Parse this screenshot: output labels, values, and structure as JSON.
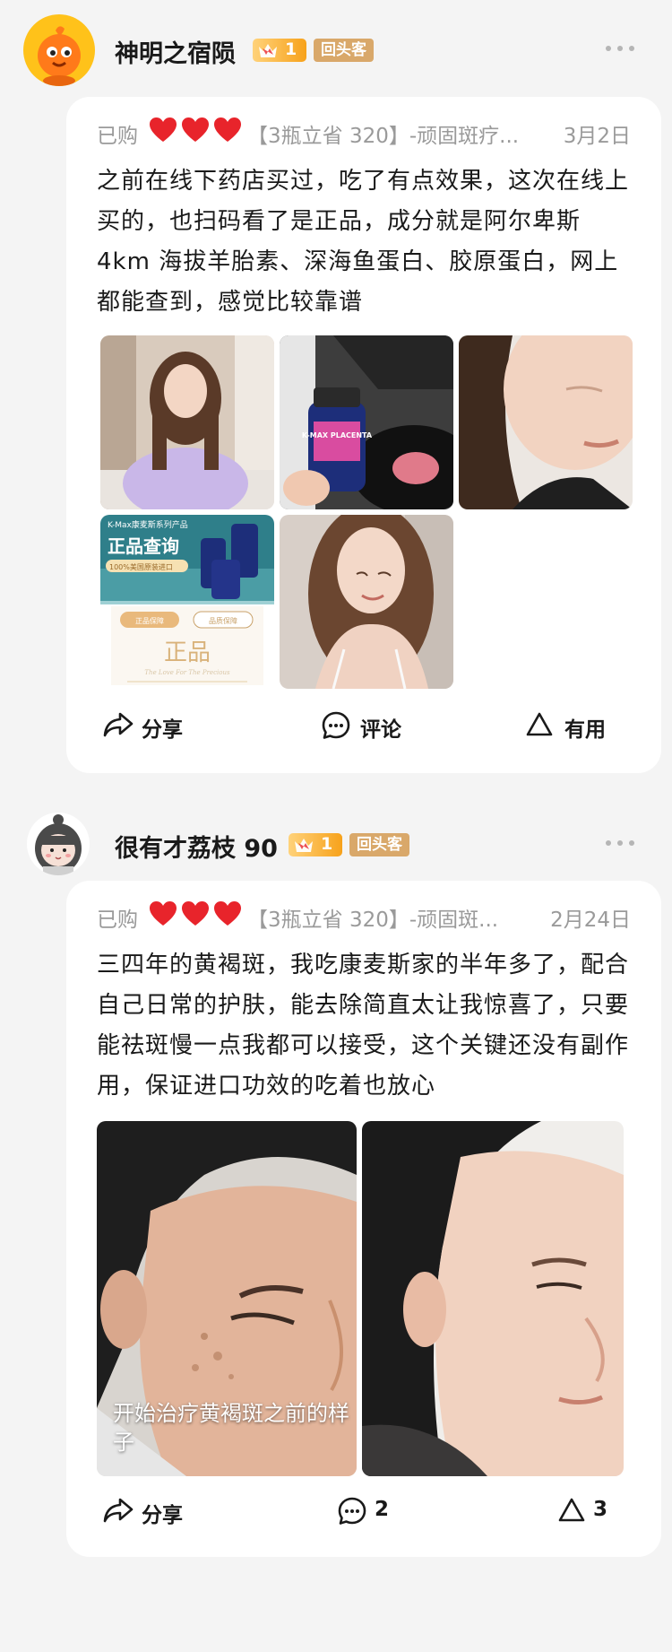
{
  "reviews": [
    {
      "username": "神明之宿陨",
      "level": "1",
      "repeat_badge": "回头客",
      "bought": "已购",
      "product": "【3瓶立省 320】-顽固斑疗...",
      "date": "3月2日",
      "text": "之前在线下药店买过，吃了有点效果，这次在线上买的，也扫码看了是正品，成分就是阿尔卑斯 4km 海拔羊胎素、深海鱼蛋白、胶原蛋白，网上都能查到，感觉比较靠谱",
      "photo_texts": {
        "brand_banner": "K-Max康麦斯系列产品",
        "query_title": "正品查询",
        "import_ribbon": "100%美国原装进口",
        "left_pill": "正品保障",
        "right_pill": "品质保障",
        "genuine_text": "正品",
        "script_text": "The Love For The Precious",
        "bottle_label": "K-MAX PLACENTA"
      },
      "actions": {
        "share": "分享",
        "comment": "评论",
        "useful": "有用"
      }
    },
    {
      "username": "很有才荔枝 90",
      "level": "1",
      "repeat_badge": "回头客",
      "bought": "已购",
      "product": "【3瓶立省 320】-顽固斑...",
      "date": "2月24日",
      "text": "三四年的黄褐斑，我吃康麦斯家的半年多了，配合自己日常的护肤，能去除简直太让我惊喜了，只要能祛斑慢一点我都可以接受，这个关键还没有副作用，保证进口功效的吃着也放心",
      "photo_caption": "开始治疗黄褐斑之前的样子",
      "actions": {
        "share": "分享",
        "comment": "2",
        "useful": "3"
      }
    }
  ],
  "colors": {
    "page_bg": "#f4f4f4",
    "heart": "#e8242b",
    "repeat_badge": "#d9a86a",
    "level_badge": "#f7a21b"
  }
}
